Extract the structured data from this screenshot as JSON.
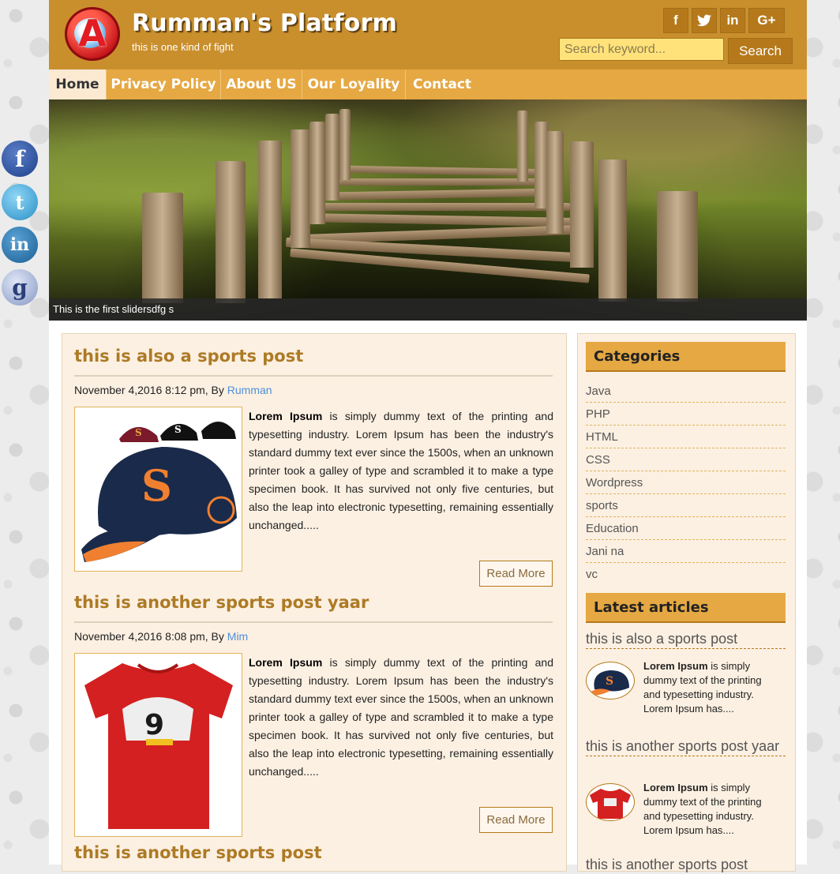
{
  "header": {
    "logo_letter": "A",
    "site_title": "Rumman's Platform",
    "tagline": "this is one kind of fight",
    "social": [
      {
        "icon": "facebook-icon",
        "glyph": "f"
      },
      {
        "icon": "twitter-icon",
        "glyph": "🐦"
      },
      {
        "icon": "linkedin-icon",
        "glyph": "in"
      },
      {
        "icon": "google-plus-icon",
        "glyph": "G+"
      }
    ],
    "search_placeholder": "Search keyword...",
    "search_button": "Search"
  },
  "nav": {
    "items": [
      "Home",
      "Privacy Policy",
      "About US",
      "Our Loyality",
      "Contact"
    ],
    "active": "Home"
  },
  "slider": {
    "caption": "This is the first slidersdfg s"
  },
  "posts": [
    {
      "title": "this is also a sports post",
      "date": "November 4,2016 8:12 pm, By",
      "author": "Rumman",
      "excerpt_bold": "Lorem Ipsum",
      "excerpt": " is simply dummy text of the printing and typesetting industry. Lorem Ipsum has been the industry's standard dummy text ever since the 1500s, when an unknown printer took a galley of type and scrambled it to make a type specimen book. It has survived not only five centuries, but also the leap into electronic typesetting, remaining essentially unchanged.....",
      "read_more": "Read More",
      "image": "caps"
    },
    {
      "title": "this is another sports post yaar",
      "date": "November 4,2016 8:08 pm, By",
      "author": "Mim",
      "excerpt_bold": "Lorem Ipsum",
      "excerpt": " is simply dummy text of the printing and typesetting industry. Lorem Ipsum has been the industry's standard dummy text ever since the 1500s, when an unknown printer took a galley of type and scrambled it to make a type specimen book. It has survived not only five centuries, but also the leap into electronic typesetting, remaining essentially unchanged.....",
      "read_more": "Read More",
      "image": "tshirt"
    },
    {
      "title": "this is another sports post"
    }
  ],
  "sidebar": {
    "categories_heading": "Categories",
    "categories": [
      "Java",
      "PHP",
      "HTML",
      "CSS",
      "Wordpress",
      "sports",
      "Education",
      "Jani na",
      "vc"
    ],
    "latest_heading": "Latest articles",
    "latest": [
      {
        "title": "this is also a sports post",
        "bold": "Lorem Ipsum",
        "text": " is simply dummy text of the printing and typesetting industry. Lorem Ipsum has...."
      },
      {
        "title": "this is another sports post yaar",
        "bold": "Lorem Ipsum",
        "text": " is simply dummy text of the printing and typesetting industry. Lorem Ipsum has...."
      },
      {
        "title": "this is another sports post"
      }
    ]
  },
  "floating_social": [
    "facebook-icon",
    "twitter-icon",
    "linkedin-icon",
    "google-icon"
  ],
  "colors": {
    "header": "#c98f2d",
    "nav": "#e5a843",
    "accent_dark": "#b5791b",
    "post_title": "#ad7a25",
    "content_bg": "#fcf0e2"
  }
}
